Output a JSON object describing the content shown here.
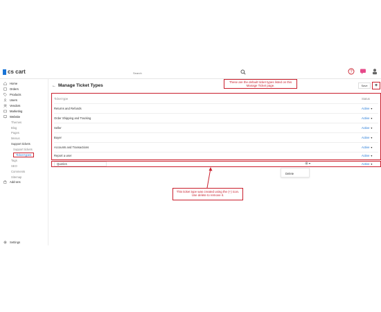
{
  "app": {
    "logo": "cs cart"
  },
  "search": {
    "placeholder": "Search"
  },
  "sidebar": {
    "items": [
      {
        "label": "Home"
      },
      {
        "label": "Orders"
      },
      {
        "label": "Products"
      },
      {
        "label": "Users"
      },
      {
        "label": "Vendors"
      },
      {
        "label": "Marketing"
      },
      {
        "label": "Website"
      },
      {
        "label": "Themes"
      },
      {
        "label": "Blog"
      },
      {
        "label": "Pages"
      },
      {
        "label": "Menus"
      },
      {
        "label": "Support tickets"
      },
      {
        "label": "Support tickets"
      },
      {
        "label": "Ticket types"
      },
      {
        "label": "Tags"
      },
      {
        "label": "SEO"
      },
      {
        "label": "Comments"
      },
      {
        "label": "Sitemap"
      },
      {
        "label": "Add-ons"
      }
    ],
    "settings_label": "Settings"
  },
  "page": {
    "title": "Manage Ticket Types",
    "save_label": "Save",
    "add_label": "+"
  },
  "table": {
    "col_type": "Ticket type",
    "col_status": "Status",
    "rows": [
      {
        "name": "Returns and Refunds",
        "status": "Active"
      },
      {
        "name": "Order Shipping and Tracking",
        "status": "Active"
      },
      {
        "name": "Seller",
        "status": "Active"
      },
      {
        "name": "Buyer",
        "status": "Active"
      },
      {
        "name": "Accounts and Transactions",
        "status": "Active"
      },
      {
        "name": "Report a user",
        "status": "Active"
      }
    ]
  },
  "new_row": {
    "value": "Queries",
    "status": "Active",
    "dropdown_item": "Delete"
  },
  "callouts": {
    "top": "These are the default ticket types listed on this Manage Ticket page.",
    "bottom": "This ticket type was created using the (+) icon. Use delete to remove it."
  },
  "colors": {
    "accent": "#1a74d6",
    "annotation": "#c91d2b"
  }
}
